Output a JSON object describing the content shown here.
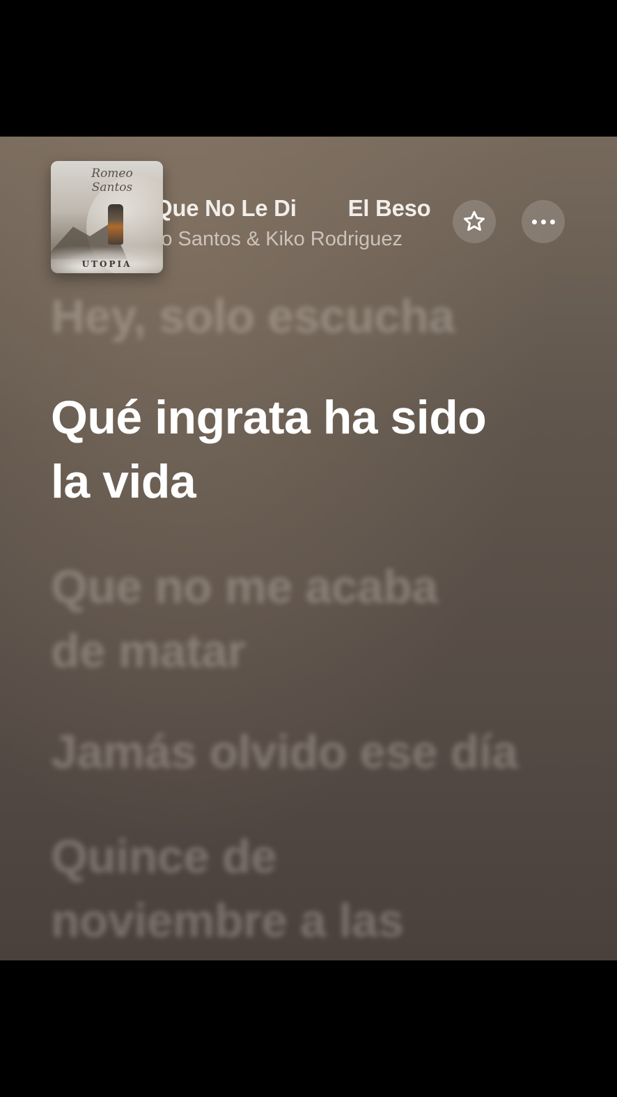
{
  "now_playing": {
    "artwork": {
      "script_text": "Romeo Santos",
      "album_name": "UTOPIA"
    },
    "title_marquee": [
      "Que No Le Di",
      "El Beso"
    ],
    "artist": "Romeo Santos & Kiko Rodriguez",
    "buttons": {
      "favorite_icon": "star-icon",
      "more_icon": "ellipsis-icon"
    }
  },
  "lyrics": {
    "previous": "Hey, solo escucha",
    "current": [
      "Qué ingrata ha sido",
      "la vida"
    ],
    "next": [
      [
        "Que no me acaba",
        "de matar"
      ],
      [
        "Jamás olvido ese día"
      ],
      [
        "Quince de",
        "noviembre a las"
      ]
    ]
  }
}
